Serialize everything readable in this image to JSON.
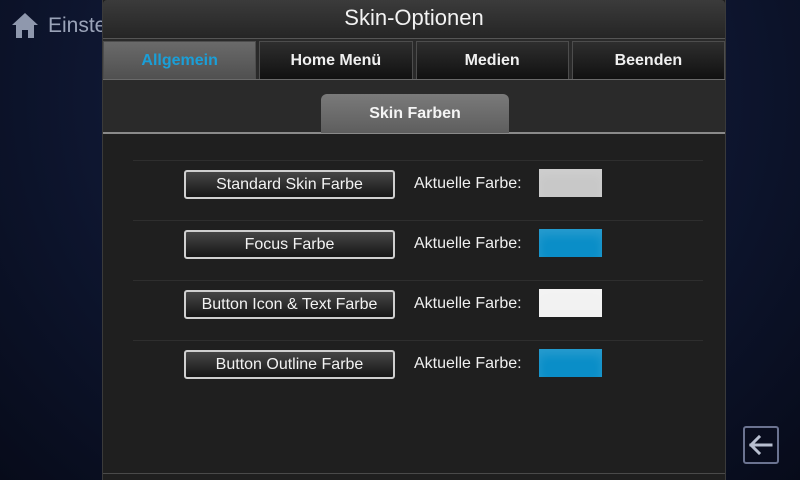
{
  "background": {
    "title": "Einste",
    "home_icon": "home-icon",
    "back_icon": "back-arrow-icon"
  },
  "dialog": {
    "title": "Skin-Optionen",
    "tabs": [
      {
        "label": "Allgemein",
        "active": true
      },
      {
        "label": "Home Menü",
        "active": false
      },
      {
        "label": "Medien",
        "active": false
      },
      {
        "label": "Beenden",
        "active": false
      }
    ],
    "subtab": "Skin Farben",
    "options": [
      {
        "button": "Standard Skin Farbe",
        "label": "Aktuelle Farbe:",
        "color": "#c8c8c8"
      },
      {
        "button": "Focus Farbe",
        "label": "Aktuelle Farbe:",
        "color": "#0a8ec8"
      },
      {
        "button": "Button Icon & Text Farbe",
        "label": "Aktuelle Farbe:",
        "color": "#f2f2f2"
      },
      {
        "button": "Button Outline Farbe",
        "label": "Aktuelle Farbe:",
        "color": "#0a8ec8"
      }
    ]
  },
  "colors": {
    "focus": "#1a9fd8",
    "dialog_bg": "#1f1f1f",
    "background": "#0e1630"
  }
}
